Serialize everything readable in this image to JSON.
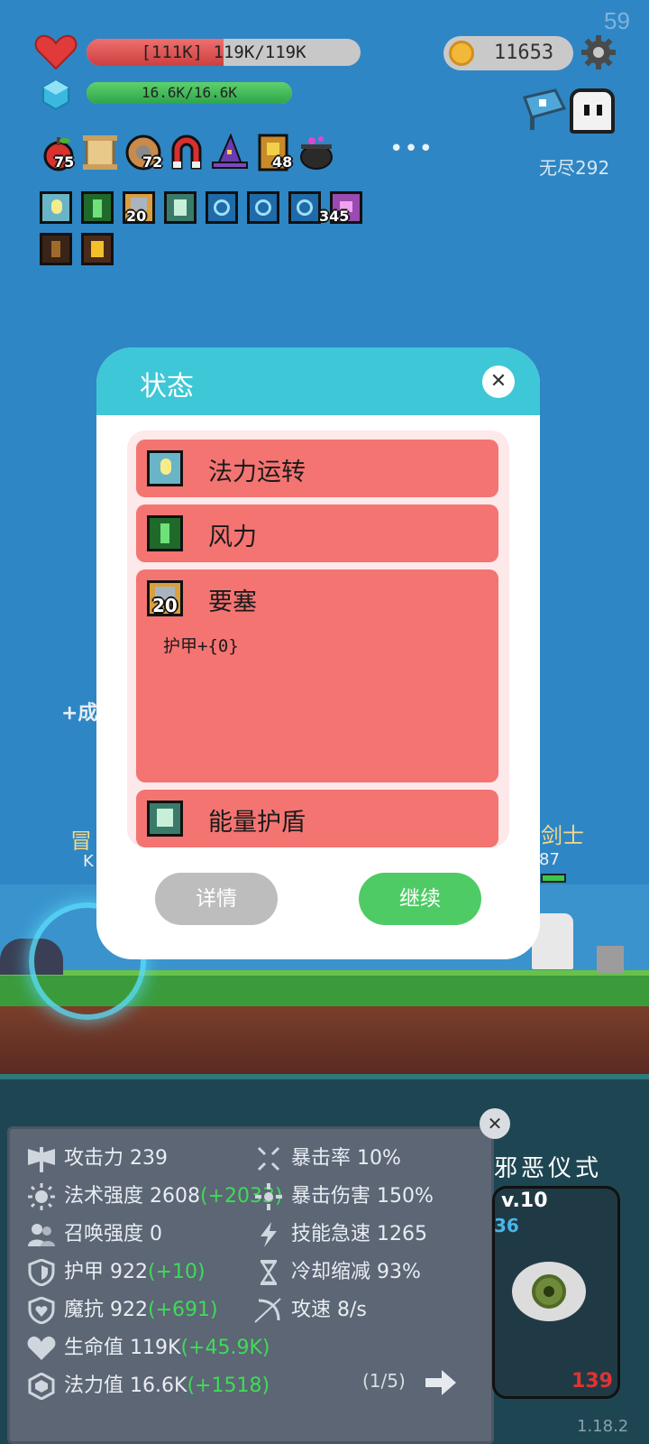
{
  "hud": {
    "fps": "59",
    "hp_text": "[111K] 119K/119K",
    "hp_fraction": 1.0,
    "shield_fraction": 0.5,
    "mp_text": "16.6K/16.6K",
    "mp_fraction": 1.0,
    "gold": "11653",
    "mode_label": "无尽292",
    "more_label": "•••"
  },
  "items": [
    {
      "icon": "apple-icon",
      "count": "75"
    },
    {
      "icon": "scroll-icon",
      "count": ""
    },
    {
      "icon": "shield-icon",
      "count": "72"
    },
    {
      "icon": "magnet-icon",
      "count": ""
    },
    {
      "icon": "wizard-hat-icon",
      "count": ""
    },
    {
      "icon": "book-icon",
      "count": "48"
    },
    {
      "icon": "cauldron-icon",
      "count": ""
    }
  ],
  "buffs_row1": [
    {
      "icon": "mana-flow-icon",
      "count": ""
    },
    {
      "icon": "wind-icon",
      "count": ""
    },
    {
      "icon": "fortress-icon",
      "count": "20"
    },
    {
      "icon": "energy-shield-icon",
      "count": ""
    },
    {
      "icon": "rune-icon",
      "count": ""
    },
    {
      "icon": "rune-icon",
      "count": ""
    },
    {
      "icon": "rune-icon",
      "count": ""
    },
    {
      "icon": "demon-icon",
      "count": "345"
    }
  ],
  "buffs_row2": [
    {
      "icon": "flame-brown-icon",
      "count": ""
    },
    {
      "icon": "flame-yellow-icon",
      "count": ""
    }
  ],
  "scene": {
    "left_text": "+成",
    "left_name": "冒",
    "left_sub": "K",
    "right_name": "剑士",
    "right_sub": "87"
  },
  "dialog": {
    "title": "状态",
    "close": "✕",
    "entries": [
      {
        "name": "法力运转",
        "desc": "",
        "count": ""
      },
      {
        "name": "风力",
        "desc": "",
        "count": ""
      },
      {
        "name": "要塞",
        "desc": "护甲+{0}",
        "count": "20"
      },
      {
        "name": "能量护盾",
        "desc": "",
        "count": ""
      }
    ],
    "details_label": "详情",
    "continue_label": "继续"
  },
  "stats": {
    "close": "✕",
    "left": [
      {
        "icon": "axe-icon",
        "label": "攻击力",
        "value": "239",
        "bonus": ""
      },
      {
        "icon": "sun-icon",
        "label": "法术强度",
        "value": "2608",
        "bonus": "(+2033)"
      },
      {
        "icon": "summon-icon",
        "label": "召唤强度",
        "value": "0",
        "bonus": ""
      },
      {
        "icon": "armor-icon",
        "label": "护甲",
        "value": "922",
        "bonus": "(+10)"
      },
      {
        "icon": "magic-resist-icon",
        "label": "魔抗",
        "value": "922",
        "bonus": "(+691)"
      },
      {
        "icon": "heart-icon",
        "label": "生命值",
        "value": "119K",
        "bonus": "(+45.9K)"
      },
      {
        "icon": "mana-icon",
        "label": "法力值",
        "value": "16.6K",
        "bonus": "(+1518)"
      }
    ],
    "right": [
      {
        "icon": "crit-rate-icon",
        "label": "暴击率",
        "value": "10%"
      },
      {
        "icon": "crit-damage-icon",
        "label": "暴击伤害",
        "value": "150%"
      },
      {
        "icon": "lightning-icon",
        "label": "技能急速",
        "value": "1265"
      },
      {
        "icon": "hourglass-icon",
        "label": "冷却缩减",
        "value": "93%"
      },
      {
        "icon": "bow-icon",
        "label": "攻速",
        "value": "8/s"
      }
    ],
    "pager": "(1/5)"
  },
  "side_card": {
    "title": "邪恶仪式",
    "level": "v.10",
    "num_top": "36",
    "num_bottom": "139"
  },
  "version": "1.18.2"
}
